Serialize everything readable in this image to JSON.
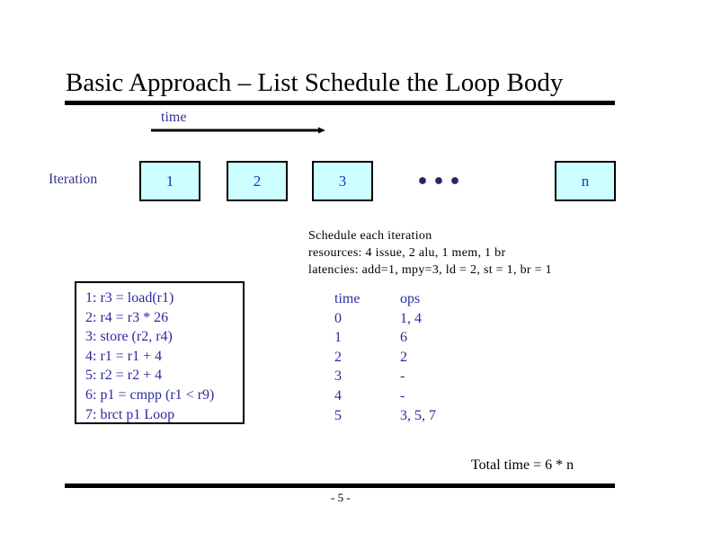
{
  "slide": {
    "title": "Basic Approach – List Schedule the Loop Body",
    "time_axis_label": "time",
    "iteration_label": "Iteration",
    "iterations": [
      "1",
      "2",
      "3",
      "n"
    ],
    "ellipsis_icon": "three-dots",
    "schedule_notes": [
      "Schedule each iteration",
      "resources: 4 issue, 2 alu, 1 mem, 1 br",
      "latencies: add=1, mpy=3, ld = 2, st = 1, br = 1"
    ],
    "code": [
      "1: r3 = load(r1)",
      "2: r4 = r3 * 26",
      "3: store (r2, r4)",
      "4: r1 = r1 + 4",
      "5: r2 = r2 + 4",
      "6: p1 = cmpp (r1 < r9)",
      "7: brct p1 Loop"
    ],
    "schedule_table": {
      "headers": [
        "time",
        "ops"
      ],
      "rows": [
        [
          "0",
          "1, 4"
        ],
        [
          "1",
          "6"
        ],
        [
          "2",
          "2"
        ],
        [
          "3",
          "-"
        ],
        [
          "4",
          "-"
        ],
        [
          "5",
          "3, 5, 7"
        ]
      ]
    },
    "total_time": "Total time = 6 * n",
    "page_number": "- 5 -",
    "colors": {
      "box_fill": "#ccffff",
      "accent_text": "#333399",
      "code_text": "#2b2b9e"
    }
  }
}
